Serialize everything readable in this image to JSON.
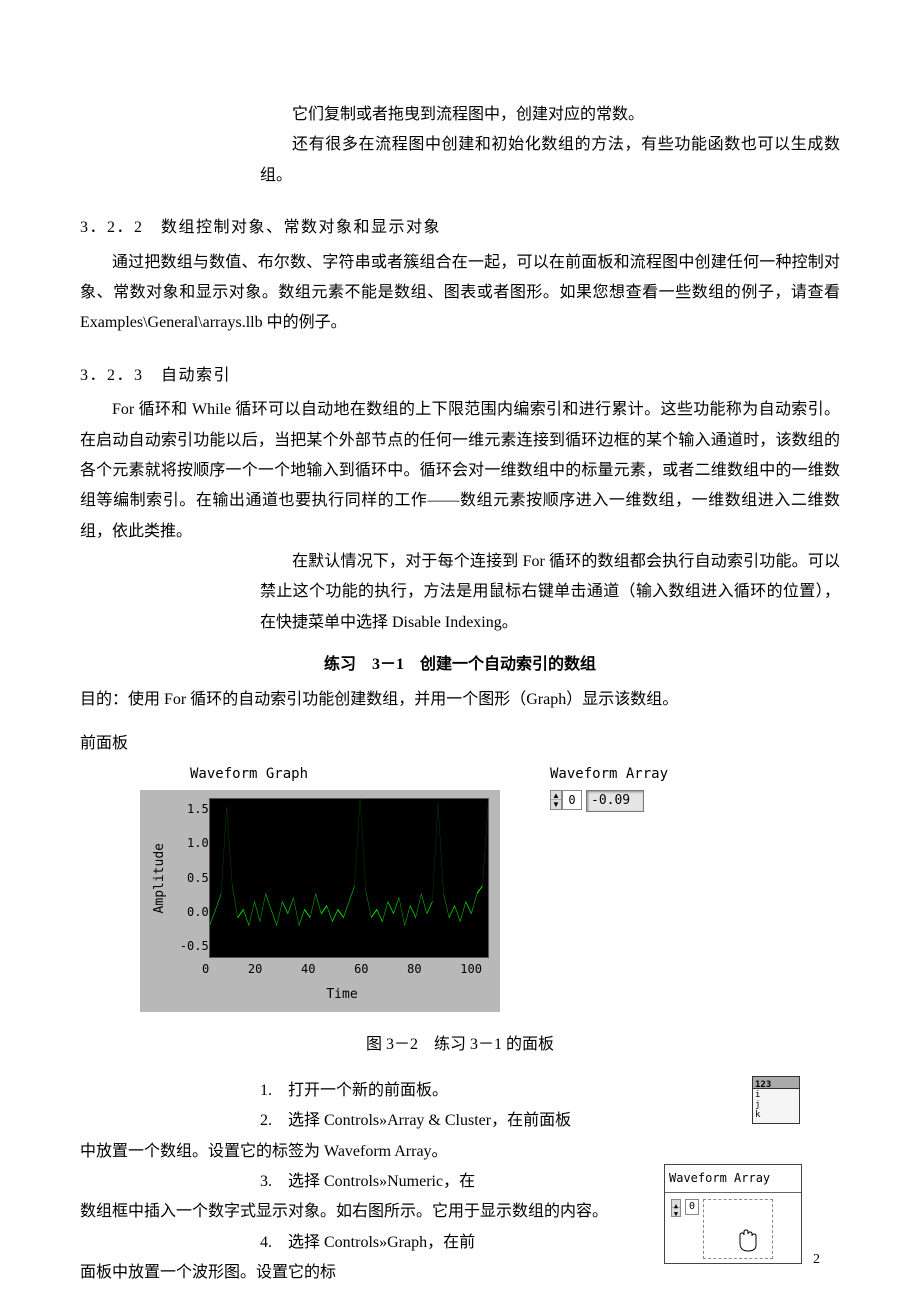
{
  "intro": {
    "line1": "它们复制或者拖曳到流程图中，创建对应的常数。",
    "line2": "还有很多在流程图中创建和初始化数组的方法，有些功能函数也可以生成数组。"
  },
  "sec322": {
    "title": "3．2．2　数组控制对象、常数对象和显示对象",
    "para": "通过把数组与数值、布尔数、字符串或者簇组合在一起，可以在前面板和流程图中创建任何一种控制对象、常数对象和显示对象。数组元素不能是数组、图表或者图形。如果您想查看一些数组的例子，请查看 Examples\\General\\arrays.llb 中的例子。"
  },
  "sec323": {
    "title": "3．2．3　自动索引",
    "para1": "For 循环和 While 循环可以自动地在数组的上下限范围内编索引和进行累计。这些功能称为自动索引。在启动自动索引功能以后，当把某个外部节点的任何一维元素连接到循环边框的某个输入通道时，该数组的各个元素就将按顺序一个一个地输入到循环中。循环会对一维数组中的标量元素，或者二维数组中的一维数组等编制索引。在输出通道也要执行同样的工作——数组元素按顺序进入一维数组，一维数组进入二维数组，依此类推。",
    "para2": "在默认情况下，对于每个连接到 For 循环的数组都会执行自动索引功能。可以禁止这个功能的执行，方法是用鼠标右键单击通道（输入数组进入循环的位置），在快捷菜单中选择 Disable Indexing。"
  },
  "exercise": {
    "title": "练习　3－1　创建一个自动索引的数组",
    "objective": "目的：使用 For 循环的自动索引功能创建数组，并用一个图形（Graph）显示该数组。"
  },
  "front_panel_label": "前面板",
  "graph": {
    "title": "Waveform Graph",
    "ylabel": "Amplitude",
    "xlabel": "Time",
    "yticks": [
      "1.5",
      "1.0",
      "0.5",
      "0.0",
      "-0.5"
    ],
    "xticks": [
      "0",
      "20",
      "40",
      "60",
      "80",
      "100"
    ]
  },
  "array_display": {
    "title": "Waveform Array",
    "index": "0",
    "value": "-0.09"
  },
  "figure_caption": "图 3－2　练习 3－1 的面板",
  "steps": {
    "s1": "打开一个新的前面板。",
    "s2a": "选择 Controls»Array & Cluster，在前面板",
    "s2b": "中放置一个数组。设置它的标签为 Waveform Array。",
    "s3a": "选择 Controls»Numeric，在",
    "s3b": "数组框中插入一个数字式显示对象。如右图所示。它用于显示数组的内容。",
    "s4a": "选择 Controls»Graph，在前",
    "s4b": "面板中放置一个波形图。设置它的标"
  },
  "icon_text": "123",
  "mini_panel": {
    "title": "Waveform Array",
    "index": "0"
  },
  "page_number": "2",
  "chart_data": {
    "type": "line",
    "title": "Waveform Graph",
    "xlabel": "Time",
    "ylabel": "Amplitude",
    "xlim": [
      0,
      100
    ],
    "ylim": [
      -0.5,
      1.5
    ],
    "x": [
      0,
      2,
      4,
      6,
      8,
      10,
      12,
      14,
      16,
      18,
      20,
      22,
      24,
      26,
      28,
      30,
      32,
      34,
      36,
      38,
      40,
      42,
      44,
      46,
      48,
      50,
      52,
      54,
      56,
      58,
      60,
      62,
      64,
      66,
      68,
      70,
      72,
      74,
      76,
      78,
      80,
      82,
      84,
      86,
      88,
      90,
      92,
      94,
      96,
      98,
      100
    ],
    "values": [
      -0.09,
      0.1,
      0.3,
      1.4,
      0.4,
      0.0,
      0.1,
      -0.1,
      0.2,
      -0.05,
      0.3,
      0.1,
      -0.1,
      0.2,
      0.05,
      0.25,
      -0.1,
      0.1,
      0.0,
      0.3,
      0.05,
      0.15,
      -0.05,
      0.1,
      0.0,
      0.2,
      0.4,
      1.5,
      0.35,
      0.0,
      0.1,
      -0.05,
      0.2,
      0.05,
      0.25,
      -0.1,
      0.15,
      0.0,
      0.3,
      0.05,
      0.2,
      1.45,
      0.3,
      0.0,
      0.15,
      -0.05,
      0.2,
      0.05,
      0.3,
      0.4,
      1.4
    ]
  }
}
